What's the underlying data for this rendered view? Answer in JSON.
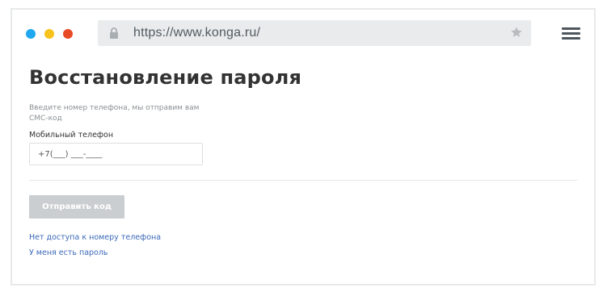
{
  "browser": {
    "url": "https://www.konga.ru/",
    "dots": [
      "#1fa8f0",
      "#f7c21b",
      "#e84a26"
    ],
    "icons": [
      "lock-icon",
      "star-icon",
      "menu-icon"
    ]
  },
  "page": {
    "title": "Восстановление пароля",
    "hint": "Введите номер телефона, мы отправим вам СМС-код",
    "phone_label": "Мобильный телефон",
    "phone_value": "+7(___) ___-____",
    "send_button": "Отправить код",
    "link_no_access": "Нет доступа к номеру телефона",
    "link_have_password": "У меня есть пароль"
  },
  "colors": {
    "link": "#3a68b8",
    "button_disabled": "#cbced0"
  }
}
